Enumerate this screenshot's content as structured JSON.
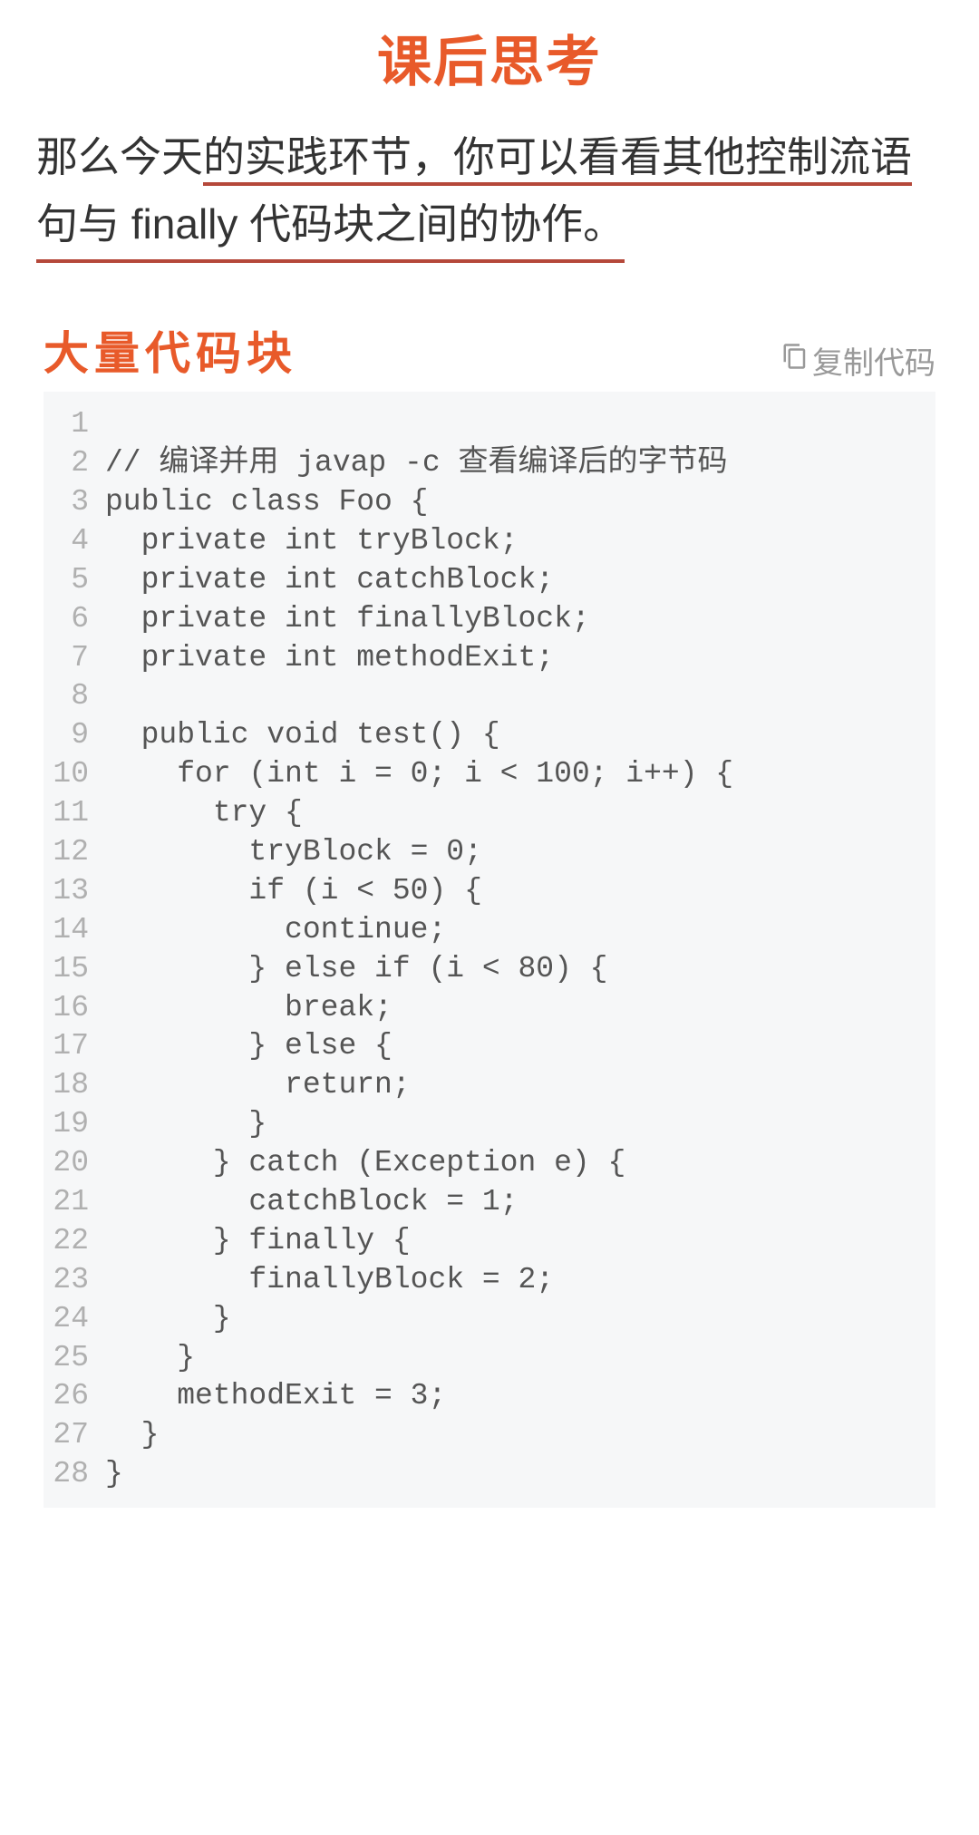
{
  "page": {
    "title": "课后思考",
    "intro_part1": "那么今天",
    "intro_underline1": "的实践环节，你可以看看其他控制流语",
    "intro_underline2": "句与 finally 代码块之间的协作。"
  },
  "code_section": {
    "title": "大量代码块",
    "copy_label": "复制代码",
    "lines": [
      "",
      "// 编译并用 javap -c 查看编译后的字节码",
      "public class Foo {",
      "  private int tryBlock;",
      "  private int catchBlock;",
      "  private int finallyBlock;",
      "  private int methodExit;",
      "",
      "  public void test() {",
      "    for (int i = 0; i < 100; i++) {",
      "      try {",
      "        tryBlock = 0;",
      "        if (i < 50) {",
      "          continue;",
      "        } else if (i < 80) {",
      "          break;",
      "        } else {",
      "          return;",
      "        }",
      "      } catch (Exception e) {",
      "        catchBlock = 1;",
      "      } finally {",
      "        finallyBlock = 2;",
      "      }",
      "    }",
      "    methodExit = 3;",
      "  }",
      "}"
    ]
  }
}
